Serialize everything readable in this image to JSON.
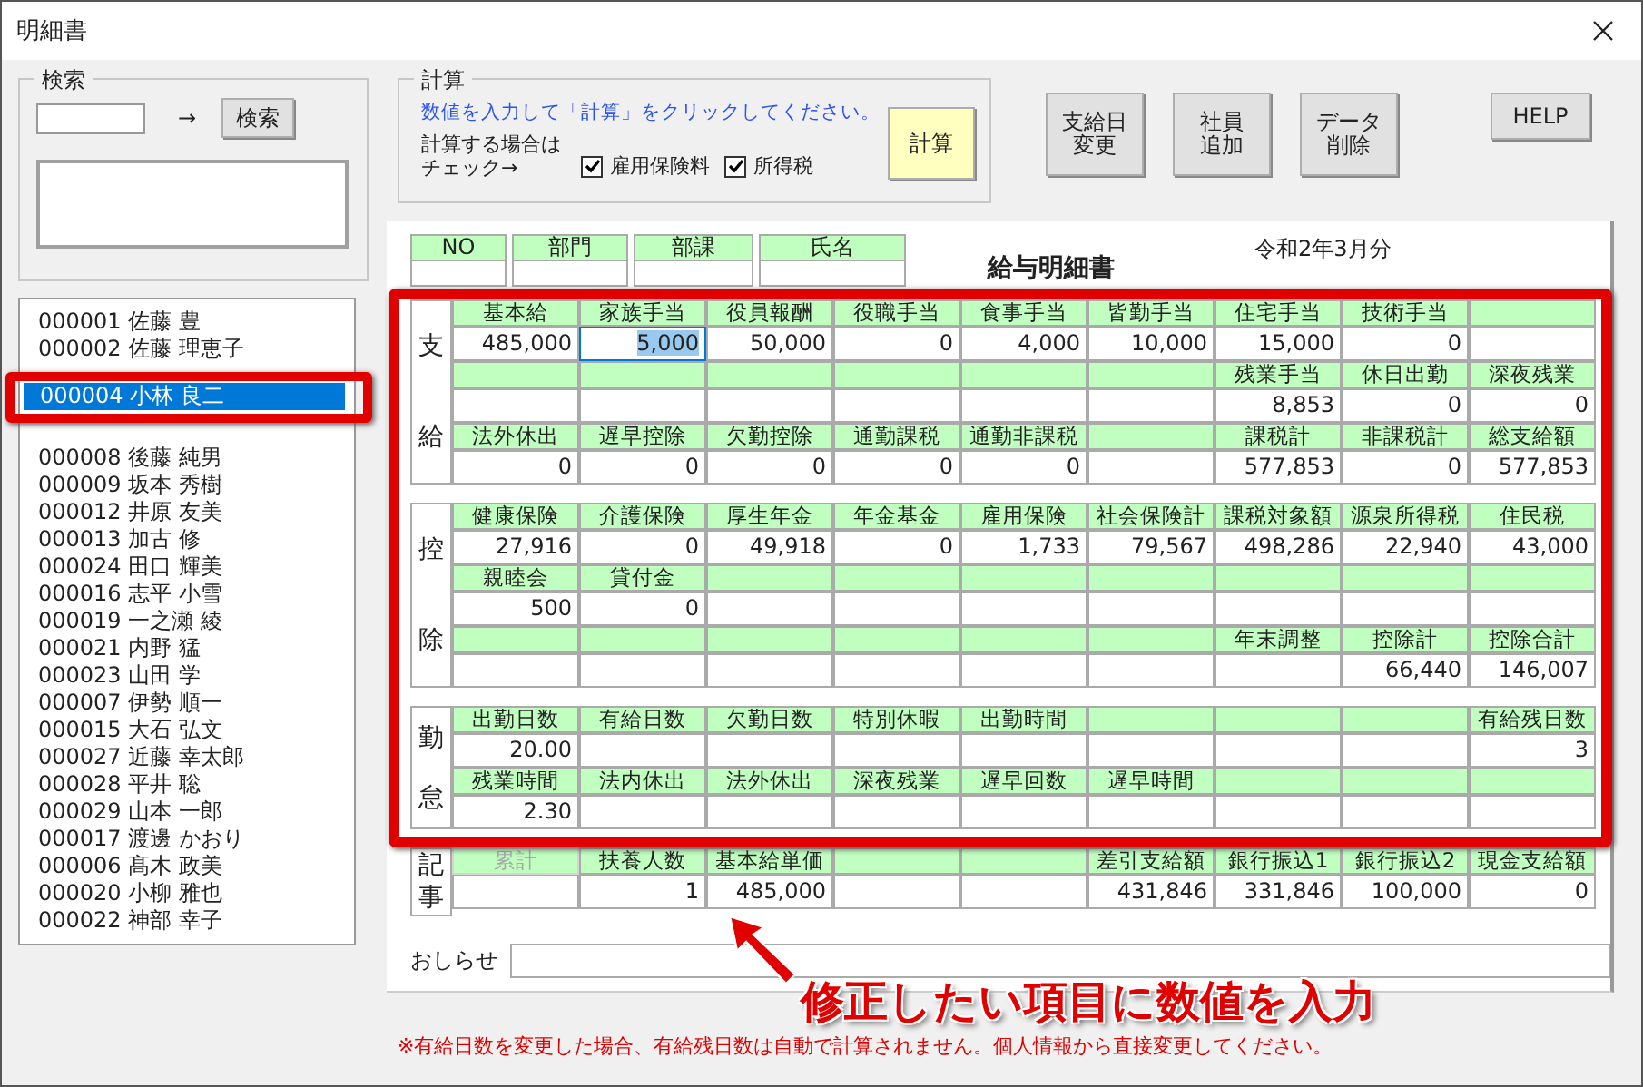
{
  "window": {
    "title": "明細書"
  },
  "search": {
    "title": "検索",
    "arrow": "→",
    "button": "検索"
  },
  "employees": [
    {
      "text": "000001 佐藤 豊",
      "selected": false
    },
    {
      "text": "000002 佐藤 理恵子",
      "selected": false
    },
    {
      "text": "000004 小林 良二",
      "selected": true
    },
    {
      "text": "000008 後藤 純男",
      "selected": false
    },
    {
      "text": "000009 坂本 秀樹",
      "selected": false
    },
    {
      "text": "000012 井原 友美",
      "selected": false
    },
    {
      "text": "000013 加古 修",
      "selected": false
    },
    {
      "text": "000024 田口 輝美",
      "selected": false
    },
    {
      "text": "000016 志平 小雪",
      "selected": false
    },
    {
      "text": "000019 一之瀬 綾",
      "selected": false
    },
    {
      "text": "000021 内野 猛",
      "selected": false
    },
    {
      "text": "000023 山田 学",
      "selected": false
    },
    {
      "text": "000007 伊勢  順一",
      "selected": false
    },
    {
      "text": "000015 大石 弘文",
      "selected": false
    },
    {
      "text": "000027 近藤 幸太郎",
      "selected": false
    },
    {
      "text": "000028 平井 聡",
      "selected": false
    },
    {
      "text": "000029 山本 一郎",
      "selected": false
    },
    {
      "text": "000017 渡邊 かおり",
      "selected": false
    },
    {
      "text": "000006 髙木 政美",
      "selected": false
    },
    {
      "text": "000020 小柳 雅也",
      "selected": false
    },
    {
      "text": "000022 神部 幸子",
      "selected": false
    }
  ],
  "calc": {
    "title": "計算",
    "hint": "数値を入力して「計算」をクリックしてください。",
    "check_label": [
      "計算する場合は",
      "チェック→"
    ],
    "checks": [
      {
        "label": "雇用保険料",
        "checked": true
      },
      {
        "label": "所得税",
        "checked": true
      }
    ],
    "button": "計算"
  },
  "buttons": [
    {
      "lines": [
        "支給日",
        "変更"
      ]
    },
    {
      "lines": [
        "社員",
        "追加"
      ]
    },
    {
      "lines": [
        "データ",
        "削除"
      ]
    }
  ],
  "help": "HELP",
  "sheet": {
    "header": [
      {
        "label": "NO"
      },
      {
        "label": "部門"
      },
      {
        "label": "部課"
      },
      {
        "label": "氏名"
      }
    ],
    "title": "給与明細書",
    "period": "令和2年3月分",
    "sections": [
      {
        "label": [
          "支",
          "給"
        ],
        "rows": [
          {
            "cells": [
              {
                "label": "基本給",
                "value": "485,000",
                "selected": false,
                "disabled": false
              },
              {
                "label": "家族手当",
                "value": "5,000",
                "selected": true,
                "disabled": false
              },
              {
                "label": "役員報酬",
                "value": "50,000",
                "selected": false,
                "disabled": false
              },
              {
                "label": "役職手当",
                "value": "0",
                "selected": false,
                "disabled": false
              },
              {
                "label": "食事手当",
                "value": "4,000",
                "selected": false,
                "disabled": false
              },
              {
                "label": "皆勤手当",
                "value": "10,000",
                "selected": false,
                "disabled": false
              },
              {
                "label": "住宅手当",
                "value": "15,000",
                "selected": false,
                "disabled": false
              },
              {
                "label": "技術手当",
                "value": "0",
                "selected": false,
                "disabled": false
              },
              {
                "selected": false,
                "disabled": false
              }
            ]
          },
          {
            "cells": [
              {
                "selected": false,
                "disabled": false
              },
              {
                "selected": false,
                "disabled": false
              },
              {
                "selected": false,
                "disabled": false
              },
              {
                "selected": false,
                "disabled": false
              },
              {
                "selected": false,
                "disabled": false
              },
              {
                "selected": false,
                "disabled": false
              },
              {
                "label": "残業手当",
                "value": "8,853",
                "selected": false,
                "disabled": false
              },
              {
                "label": "休日出勤",
                "value": "0",
                "selected": false,
                "disabled": false
              },
              {
                "label": "深夜残業",
                "value": "0",
                "selected": false,
                "disabled": false
              }
            ]
          },
          {
            "cells": [
              {
                "label": "法外休出",
                "value": "0",
                "selected": false,
                "disabled": false
              },
              {
                "label": "遅早控除",
                "value": "0",
                "selected": false,
                "disabled": false
              },
              {
                "label": "欠勤控除",
                "value": "0",
                "selected": false,
                "disabled": false
              },
              {
                "label": "通勤課税",
                "value": "0",
                "selected": false,
                "disabled": false
              },
              {
                "label": "通勤非課税",
                "value": "0",
                "selected": false,
                "disabled": false
              },
              {
                "selected": false,
                "disabled": false
              },
              {
                "label": "課税計",
                "value": "577,853",
                "selected": false,
                "disabled": false
              },
              {
                "label": "非課税計",
                "value": "0",
                "selected": false,
                "disabled": false
              },
              {
                "label": "総支給額",
                "value": "577,853",
                "selected": false,
                "disabled": false
              }
            ]
          }
        ]
      },
      {
        "label": [
          "控",
          "除"
        ],
        "rows": [
          {
            "cells": [
              {
                "label": "健康保険",
                "value": "27,916",
                "selected": false,
                "disabled": false
              },
              {
                "label": "介護保険",
                "value": "0",
                "selected": false,
                "disabled": false
              },
              {
                "label": "厚生年金",
                "value": "49,918",
                "selected": false,
                "disabled": false
              },
              {
                "label": "年金基金",
                "value": "0",
                "selected": false,
                "disabled": false
              },
              {
                "label": "雇用保険",
                "value": "1,733",
                "selected": false,
                "disabled": false
              },
              {
                "label": "社会保険計",
                "value": "79,567",
                "selected": false,
                "disabled": false
              },
              {
                "label": "課税対象額",
                "value": "498,286",
                "selected": false,
                "disabled": false
              },
              {
                "label": "源泉所得税",
                "value": "22,940",
                "selected": false,
                "disabled": false
              },
              {
                "label": "住民税",
                "value": "43,000",
                "selected": false,
                "disabled": false
              }
            ]
          },
          {
            "cells": [
              {
                "label": "親睦会",
                "value": "500",
                "selected": false,
                "disabled": false
              },
              {
                "label": "貸付金",
                "value": "0",
                "selected": false,
                "disabled": false
              },
              {
                "selected": false,
                "disabled": false
              },
              {
                "selected": false,
                "disabled": false
              },
              {
                "selected": false,
                "disabled": false
              },
              {
                "selected": false,
                "disabled": false
              },
              {
                "selected": false,
                "disabled": false
              },
              {
                "selected": false,
                "disabled": false
              },
              {
                "selected": false,
                "disabled": false
              }
            ]
          },
          {
            "cells": [
              {
                "selected": false,
                "disabled": false
              },
              {
                "selected": false,
                "disabled": false
              },
              {
                "selected": false,
                "disabled": false
              },
              {
                "selected": false,
                "disabled": false
              },
              {
                "selected": false,
                "disabled": false
              },
              {
                "selected": false,
                "disabled": false
              },
              {
                "label": "年末調整",
                "selected": false,
                "disabled": false
              },
              {
                "label": "控除計",
                "value": "66,440",
                "selected": false,
                "disabled": false
              },
              {
                "label": "控除合計",
                "value": "146,007",
                "selected": false,
                "disabled": false
              }
            ]
          }
        ]
      },
      {
        "label": [
          "勤",
          "怠"
        ],
        "rows": [
          {
            "cells": [
              {
                "label": "出勤日数",
                "value": "20.00",
                "selected": false,
                "disabled": false
              },
              {
                "label": "有給日数",
                "selected": false,
                "disabled": false
              },
              {
                "label": "欠勤日数",
                "selected": false,
                "disabled": false
              },
              {
                "label": "特別休暇",
                "selected": false,
                "disabled": false
              },
              {
                "label": "出勤時間",
                "selected": false,
                "disabled": false
              },
              {
                "selected": false,
                "disabled": false
              },
              {
                "selected": false,
                "disabled": false
              },
              {
                "selected": false,
                "disabled": false
              },
              {
                "label": "有給残日数",
                "value": "3",
                "selected": false,
                "disabled": false
              }
            ]
          },
          {
            "cells": [
              {
                "label": "残業時間",
                "value": "2.30",
                "selected": false,
                "disabled": false
              },
              {
                "label": "法内休出",
                "selected": false,
                "disabled": false
              },
              {
                "label": "法外休出",
                "selected": false,
                "disabled": false
              },
              {
                "label": "深夜残業",
                "selected": false,
                "disabled": false
              },
              {
                "label": "遅早回数",
                "selected": false,
                "disabled": false
              },
              {
                "label": "遅早時間",
                "selected": false,
                "disabled": false
              },
              {
                "selected": false,
                "disabled": false
              },
              {
                "selected": false,
                "disabled": false
              },
              {
                "selected": false,
                "disabled": false
              }
            ]
          }
        ]
      },
      {
        "label": [
          "記",
          "事"
        ],
        "rows": [
          {
            "cells": [
              {
                "label": "累計",
                "selected": false,
                "disabled": true
              },
              {
                "label": "扶養人数",
                "value": "1",
                "selected": false,
                "disabled": false
              },
              {
                "label": "基本給単価",
                "value": "485,000",
                "selected": false,
                "disabled": false
              },
              {
                "selected": false,
                "disabled": false
              },
              {
                "selected": false,
                "disabled": false
              },
              {
                "label": "差引支給額",
                "value": "431,846",
                "selected": false,
                "disabled": false
              },
              {
                "label": "銀行振込1",
                "value": "331,846",
                "selected": false,
                "disabled": false
              },
              {
                "label": "銀行振込2",
                "value": "100,000",
                "selected": false,
                "disabled": false
              },
              {
                "label": "現金支給額",
                "value": "0",
                "selected": false,
                "disabled": false
              }
            ]
          }
        ]
      }
    ],
    "notice_label": "おしらせ"
  },
  "note": "※有給日数を変更した場合、有給残日数は自動で計算されません。個人情報から直接変更してください。",
  "annotation": {
    "callout": "修正したい項目に数値を入力"
  }
}
